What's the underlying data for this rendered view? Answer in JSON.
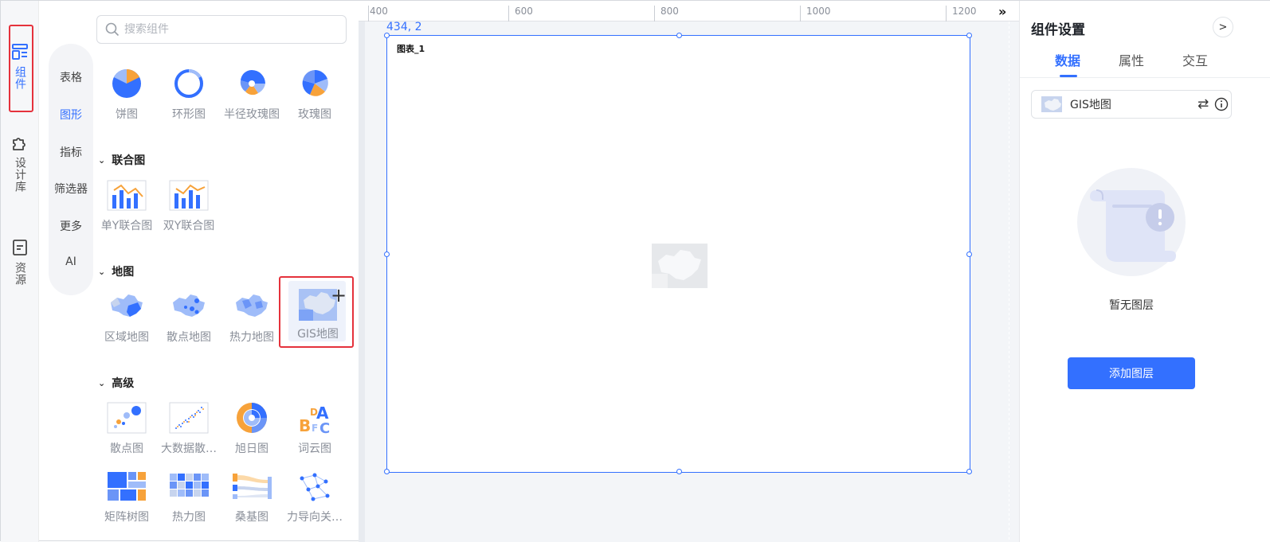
{
  "rail": {
    "items": [
      {
        "label": "组件",
        "icon": "components-icon",
        "active": true
      },
      {
        "label": "设计库",
        "icon": "puzzle-icon",
        "active": false
      },
      {
        "label": "资源",
        "icon": "resource-doc-icon",
        "active": false
      }
    ]
  },
  "search": {
    "placeholder": "搜索组件",
    "value": ""
  },
  "categories": [
    {
      "label": "表格",
      "active": false
    },
    {
      "label": "图形",
      "active": true
    },
    {
      "label": "指标",
      "active": false
    },
    {
      "label": "筛选器",
      "active": false
    },
    {
      "label": "更多",
      "active": false
    },
    {
      "label": "AI",
      "active": false
    }
  ],
  "components": {
    "pie_group": {
      "items": [
        "饼图",
        "环形图",
        "半径玫瑰图",
        "玫瑰图"
      ]
    },
    "combo": {
      "title": "联合图",
      "items": [
        "单Y联合图",
        "双Y联合图"
      ]
    },
    "map": {
      "title": "地图",
      "items": [
        "区域地图",
        "散点地图",
        "热力地图",
        "GIS地图"
      ]
    },
    "advanced": {
      "title": "高级",
      "items": [
        "散点图",
        "大数据散…",
        "旭日图",
        "词云图",
        "矩阵树图",
        "热力图",
        "桑基图",
        "力导向关…"
      ]
    }
  },
  "canvas": {
    "ruler_ticks": [
      "400",
      "600",
      "800",
      "1000",
      "1200"
    ],
    "coords": "434, 2",
    "chart_name": "图表_1"
  },
  "right_panel": {
    "title": "组件设置",
    "tabs": [
      {
        "label": "数据",
        "active": true
      },
      {
        "label": "属性",
        "active": false
      },
      {
        "label": "交互",
        "active": false
      }
    ],
    "layer_select": "GIS地图",
    "empty_text": "暂无图层",
    "add_button": "添加图层"
  },
  "colors": {
    "accent": "#3370ff",
    "highlight": "#e5323c",
    "orange": "#f7a23a"
  }
}
